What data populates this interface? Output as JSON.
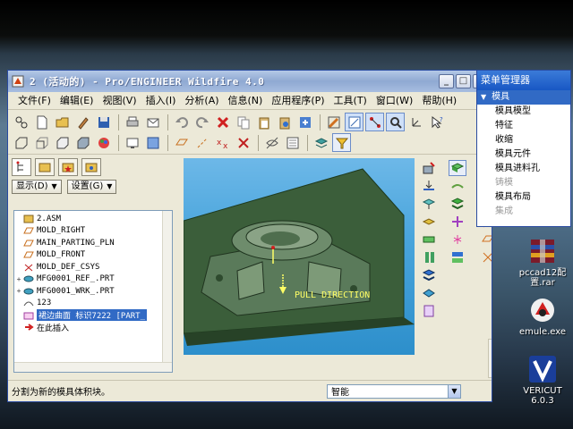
{
  "window": {
    "title": "2 (活动的) - Pro/ENGINEER Wildfire 4.0"
  },
  "menubar": [
    {
      "label": "文件(F)"
    },
    {
      "label": "编辑(E)"
    },
    {
      "label": "视图(V)"
    },
    {
      "label": "插入(I)"
    },
    {
      "label": "分析(A)"
    },
    {
      "label": "信息(N)"
    },
    {
      "label": "应用程序(P)"
    },
    {
      "label": "工具(T)"
    },
    {
      "label": "窗口(W)"
    },
    {
      "label": "帮助(H)"
    }
  ],
  "left_panel": {
    "show_label": "显示(D)",
    "settings_label": "设置(G)",
    "tree": [
      {
        "label": "2.ASM",
        "icon": "assembly-icon",
        "expander": ""
      },
      {
        "label": "MOLD_RIGHT",
        "icon": "datum-plane-icon",
        "expander": ""
      },
      {
        "label": "MAIN_PARTING_PLN",
        "icon": "datum-plane-icon",
        "expander": ""
      },
      {
        "label": "MOLD_FRONT",
        "icon": "datum-plane-icon",
        "expander": ""
      },
      {
        "label": "MOLD_DEF_CSYS",
        "icon": "csys-icon",
        "expander": ""
      },
      {
        "label": "MFG0001_REF_.PRT",
        "icon": "part-icon",
        "expander": "+"
      },
      {
        "label": "MFG0001_WRK_.PRT",
        "icon": "part-icon",
        "expander": "+"
      },
      {
        "label": "123",
        "icon": "curve-icon",
        "expander": ""
      },
      {
        "label": "裙边曲面 标识7222 [PART_",
        "icon": "surface-icon",
        "expander": "",
        "selected": true
      },
      {
        "label": "在此插入",
        "icon": "insert-arrow-icon",
        "expander": ""
      }
    ]
  },
  "viewport": {
    "pull_direction_label": "PULL DIRECTION"
  },
  "status": {
    "message": "分割为新的模具体积块。",
    "filter_value": "智能"
  },
  "menu_manager": {
    "title": "菜单管理器",
    "header": "模具",
    "items": [
      {
        "label": "模具模型",
        "enabled": true
      },
      {
        "label": "特征",
        "enabled": true
      },
      {
        "label": "收缩",
        "enabled": true
      },
      {
        "label": "模具元件",
        "enabled": true
      },
      {
        "label": "模具进料孔",
        "enabled": true
      },
      {
        "label": "铸模",
        "enabled": false
      },
      {
        "label": "模具布局",
        "enabled": true
      },
      {
        "label": "集成",
        "enabled": false
      }
    ]
  },
  "desktop": {
    "icons": [
      {
        "label": "pccad12配置.rar",
        "icon": "winrar-icon"
      },
      {
        "label": "emule.exe",
        "icon": "emule-icon"
      },
      {
        "label": "VERICUT 6.0.3",
        "icon": "vericut-icon"
      }
    ]
  },
  "colors": {
    "title_bar": "#8fa9d2",
    "selection": "#316ac5",
    "viewport_bg": "#4aa5dc",
    "mold_green": "#3b5e3a",
    "pull_direction_text": "#ffff66",
    "menu_manager_title": "#1857c4"
  }
}
